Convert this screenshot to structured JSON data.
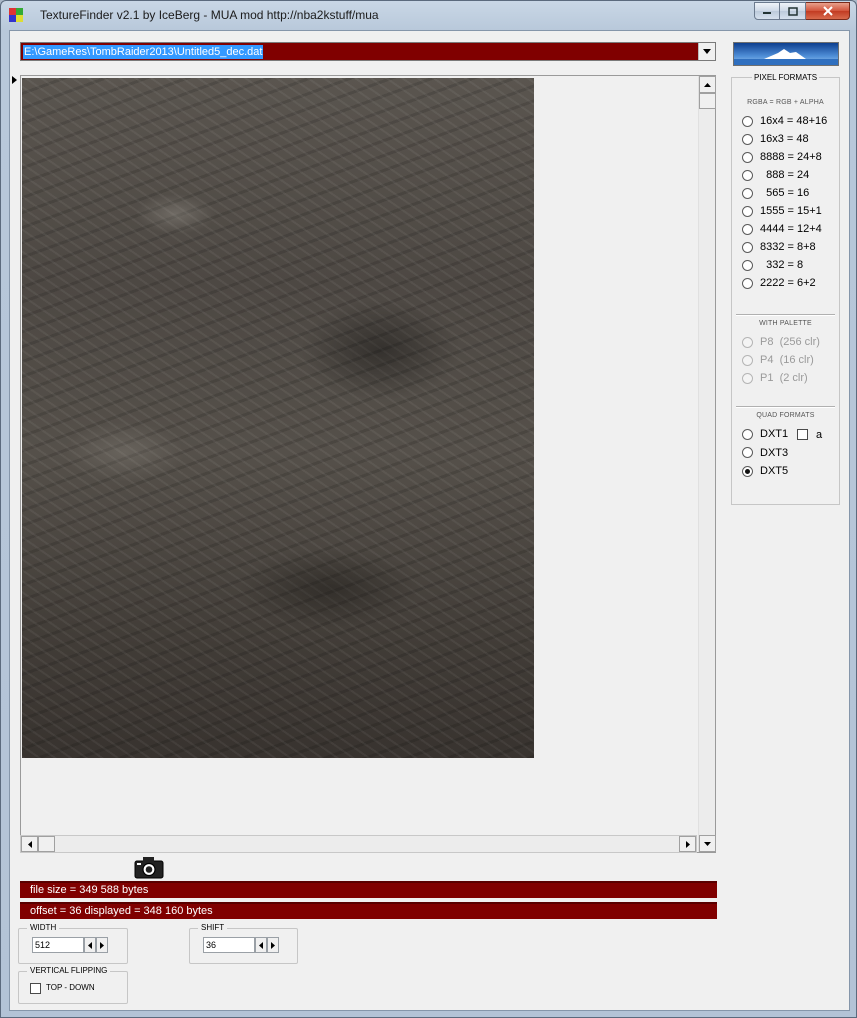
{
  "window": {
    "title": "TextureFinder v2.1 by IceBerg - MUA mod http://nba2kstuff/mua"
  },
  "file_path": "E:\\GameRes\\TombRaider2013\\Untitled5_dec.dat",
  "info": {
    "file_size": "file size = 349 588 bytes",
    "offset": "offset = 36   displayed = 348 160 bytes"
  },
  "width_group": {
    "label": "WIDTH",
    "value": "512"
  },
  "shift_group": {
    "label": "SHIFT",
    "value": "36"
  },
  "flip_group": {
    "label": "VERTICAL FLIPPING",
    "option": "TOP - DOWN",
    "checked": false
  },
  "formats": {
    "title": "PIXEL FORMATS",
    "rgba_header": "RGBA = RGB + ALPHA",
    "rgba": [
      "16x4 = 48+16",
      "16x3 = 48",
      "8888 = 24+8",
      "  888 = 24",
      "  565 = 16",
      "1555 = 15+1",
      "4444 = 12+4",
      "8332 = 8+8",
      "  332 = 8",
      "2222 = 6+2"
    ],
    "palette_header": "WITH PALETTE",
    "palette": [
      "P8  (256 clr)",
      "P4  (16 clr)",
      "P1  (2 clr)"
    ],
    "quad_header": "QUAD FORMATS",
    "quad": [
      "DXT1",
      "DXT3",
      "DXT5"
    ],
    "dxt1_alpha_label": "a",
    "selected": "DXT5"
  },
  "colors": {
    "info_bar": "#800000",
    "selection": "#3399ff"
  }
}
